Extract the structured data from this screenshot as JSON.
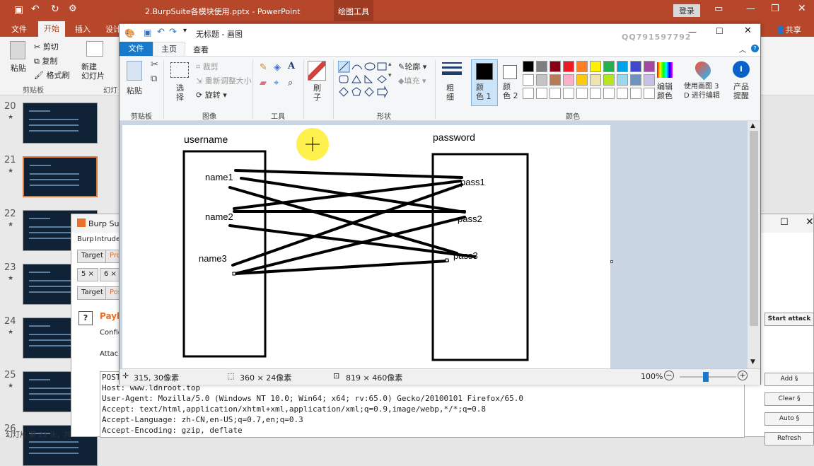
{
  "powerpoint": {
    "title": "2.BurpSuite各模块使用.pptx  -  PowerPoint",
    "context_tab": "绘图工具",
    "login": "登录",
    "share": "共享",
    "tabs": [
      "文件",
      "开始",
      "插入",
      "设计"
    ],
    "ribbon": {
      "paste": "粘贴",
      "cut": "剪切",
      "copy": "复制",
      "format_painter": "格式刷",
      "clipboard_group": "剪贴板",
      "new_slide": "新建\n幻灯片",
      "slides_group": "幻灯"
    },
    "slides": [
      {
        "num": "20",
        "star": "★"
      },
      {
        "num": "21",
        "star": "★"
      },
      {
        "num": "22",
        "star": "★"
      },
      {
        "num": "23",
        "star": "★"
      },
      {
        "num": "24",
        "star": "★"
      },
      {
        "num": "25",
        "star": "★"
      },
      {
        "num": "26",
        "star": ""
      }
    ],
    "status": "幻灯片 第 21 张，共"
  },
  "burp": {
    "title": "Burp Suit",
    "menu": [
      "Burp",
      "Intruder"
    ],
    "tabs_row1": [
      "Target",
      "Pro"
    ],
    "tabs_row2": [
      "5 ×",
      "6 ×"
    ],
    "tabs_row3": [
      "Target",
      "Pos"
    ],
    "section_title": "Paylo",
    "config_text": "Config",
    "attack_text": "Attack",
    "start_attack": "Start attack",
    "add": "Add §",
    "clear": "Clear §",
    "auto": "Auto §",
    "refresh": "Refresh",
    "request_lines": [
      "POST",
      "Host: www.ldnroot.top",
      "User-Agent: Mozilla/5.0 (Windows NT 10.0; Win64; x64; rv:65.0) Gecko/20100101 Firefox/65.0",
      "Accept: text/html,application/xhtml+xml,application/xml;q=0.9,image/webp,*/*;q=0.8",
      "Accept-Language: zh-CN,en-US;q=0.7,en;q=0.3",
      "Accept-Encoding: gzip, deflate"
    ]
  },
  "paint": {
    "title": "无标题 - 画图",
    "watermark": "QQ791597792",
    "tabs": [
      "文件",
      "主页",
      "查看"
    ],
    "ribbon": {
      "paste": "粘贴",
      "select": "选\n择",
      "crop": "裁剪",
      "resize": "重新调整大小",
      "rotate": "旋转",
      "image_group": "图像",
      "clipboard_group": "剪贴板",
      "tools_group": "工具",
      "brush": "刷\n子",
      "shapes_group": "形状",
      "outline": "轮廓",
      "fill": "填充",
      "size": "粗\n细",
      "color1": "颜\n色 1",
      "color2": "颜\n色 2",
      "colors_group": "颜色",
      "edit_colors": "编辑\n颜色",
      "paint3d": "使用画图 3\nD 进行编辑",
      "product_alert": "产品\n提醒"
    },
    "palette": [
      "#000000",
      "#7f7f7f",
      "#880015",
      "#ed1c24",
      "#ff7f27",
      "#fff200",
      "#22b14c",
      "#00a2e8",
      "#3f48cc",
      "#a349a4",
      "#ffffff",
      "#c3c3c3",
      "#b97a57",
      "#ffaec9",
      "#ffc90e",
      "#efe4b0",
      "#b5e61d",
      "#99d9ea",
      "#7092be",
      "#c8bfe7",
      "#ffffff",
      "#ffffff",
      "#ffffff",
      "#ffffff",
      "#ffffff",
      "#ffffff",
      "#ffffff",
      "#ffffff",
      "#ffffff",
      "#ffffff"
    ],
    "canvas_text": {
      "username": "username",
      "password": "password",
      "name1": "name1",
      "name2": "name2",
      "name3": "name3",
      "pass1": "pass1",
      "pass2": "pass2",
      "pass3": "pass3"
    },
    "status": {
      "position": "315, 30像素",
      "selection": "360 × 24像素",
      "size": "819 × 460像素",
      "zoom": "100%"
    }
  }
}
